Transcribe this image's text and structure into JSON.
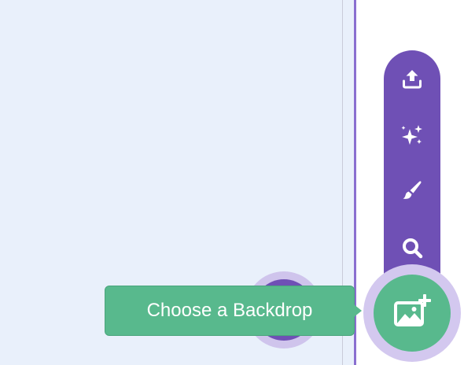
{
  "tooltip": {
    "text": "Choose a Backdrop"
  },
  "menu": {
    "items": [
      {
        "icon": "upload-icon"
      },
      {
        "icon": "surprise-sparkle-icon"
      },
      {
        "icon": "paint-brush-icon"
      },
      {
        "icon": "search-icon"
      }
    ]
  },
  "main_button": {
    "icon": "add-backdrop-icon"
  },
  "colors": {
    "menu_purple": "#6f50b5",
    "halo_purple": "#d3c8ef",
    "action_green": "#58b98d",
    "stage_background": "#e9f0fb"
  }
}
